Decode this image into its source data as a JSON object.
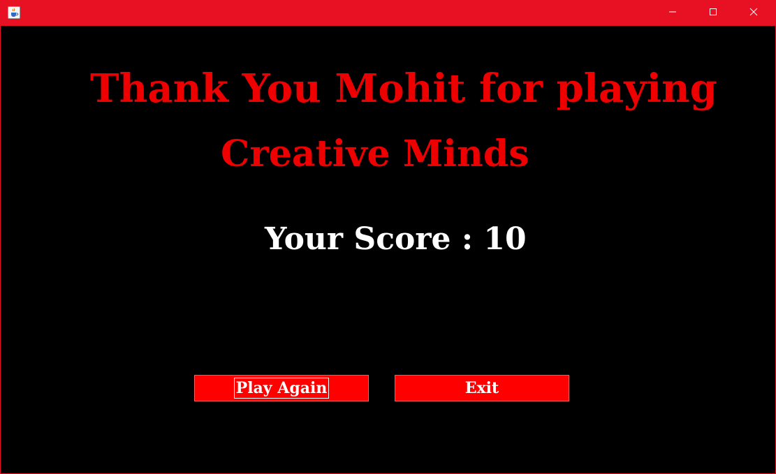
{
  "window": {
    "title": "",
    "accent_color": "#e81123",
    "icon": "java-cup-icon",
    "controls": {
      "minimize_icon": "minimize-icon",
      "maximize_icon": "maximize-icon",
      "close_icon": "close-icon"
    }
  },
  "content": {
    "background": "#000000",
    "title_line1": "Thank You Mohit for playing",
    "title_line2": "Creative Minds",
    "title_color": "#ee0000",
    "score_text": "Your Score : 10",
    "score_color": "#ffffff"
  },
  "buttons": {
    "play_again_label": "Play Again",
    "exit_label": "Exit",
    "button_color": "#ff0000"
  }
}
